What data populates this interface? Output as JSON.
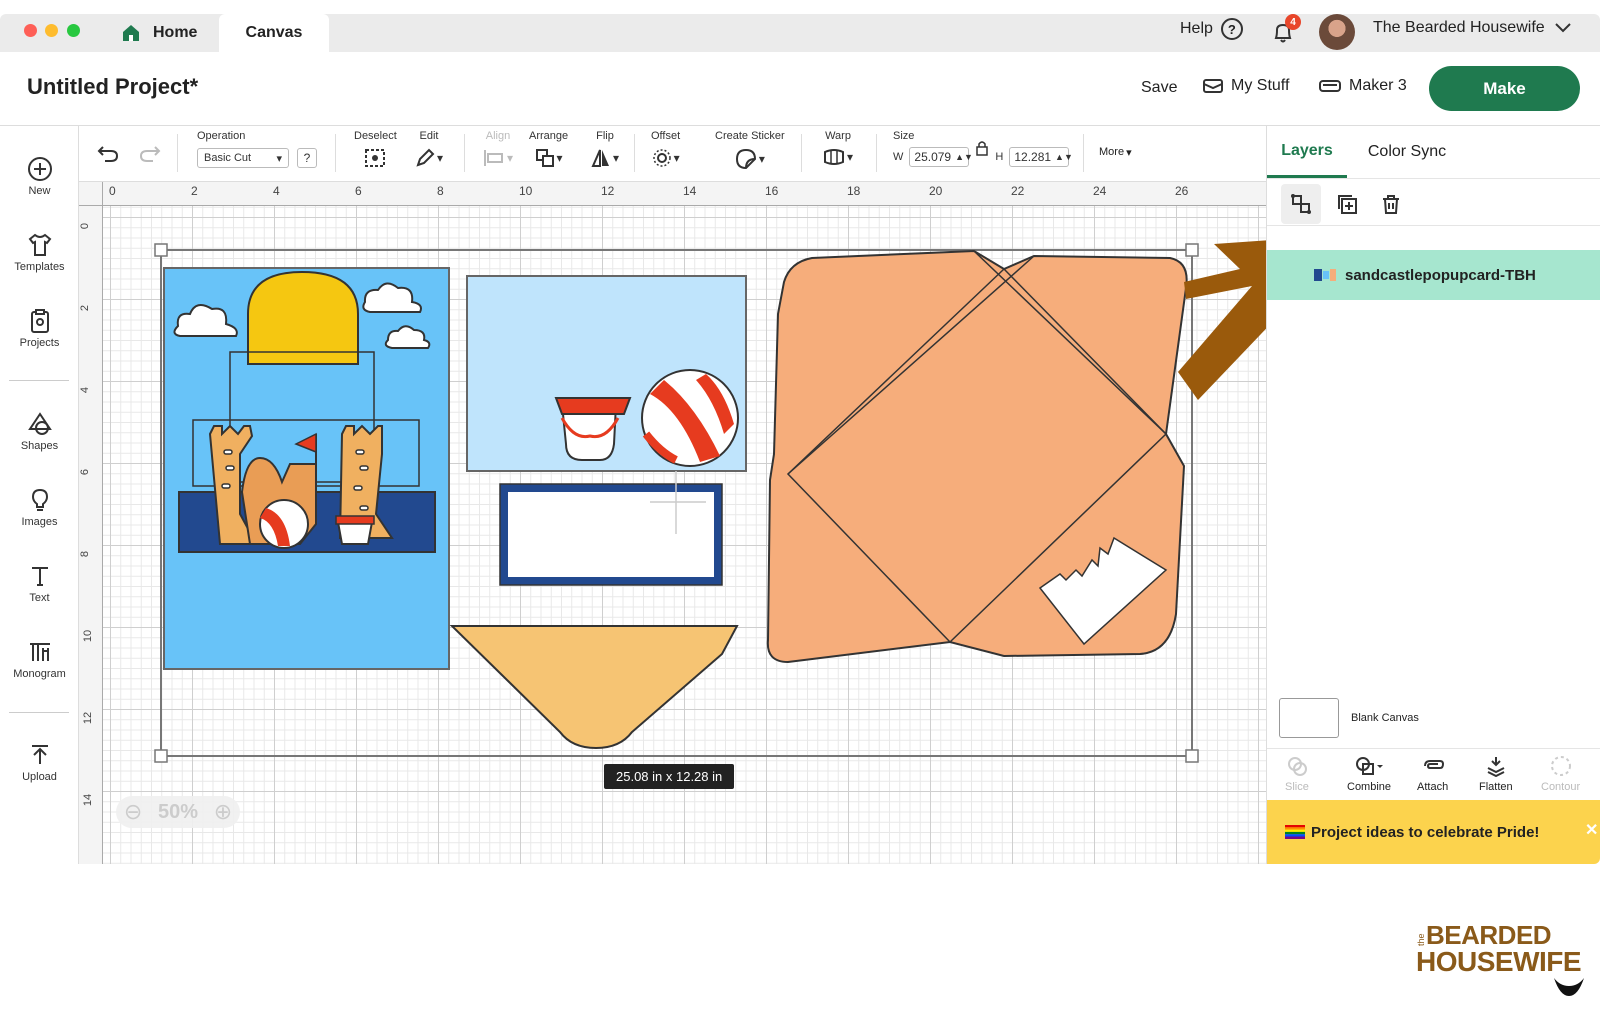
{
  "window": {
    "tabs": [
      {
        "label": "Home"
      },
      {
        "label": "Canvas"
      }
    ]
  },
  "topbar": {
    "help_label": "Help",
    "notification_count": "4",
    "user_name": "The Bearded Housewife"
  },
  "header": {
    "project_title": "Untitled Project*",
    "save_label": "Save",
    "mystuff_label": "My Stuff",
    "maker_label": "Maker 3",
    "make_label": "Make"
  },
  "sidebar": {
    "items": [
      {
        "label": "New",
        "icon": "plus-circle-icon"
      },
      {
        "label": "Templates",
        "icon": "shirt-icon"
      },
      {
        "label": "Projects",
        "icon": "clipboard-icon"
      },
      {
        "label": "Shapes",
        "icon": "shapes-icon"
      },
      {
        "label": "Images",
        "icon": "lightbulb-icon"
      },
      {
        "label": "Text",
        "icon": "text-icon"
      },
      {
        "label": "Monogram",
        "icon": "monogram-icon"
      },
      {
        "label": "Upload",
        "icon": "upload-icon"
      }
    ]
  },
  "toolbar": {
    "operation_label": "Operation",
    "operation_value": "Basic Cut",
    "help_q": "?",
    "deselect_label": "Deselect",
    "edit_label": "Edit",
    "align_label": "Align",
    "arrange_label": "Arrange",
    "flip_label": "Flip",
    "offset_label": "Offset",
    "sticker_label": "Create Sticker",
    "warp_label": "Warp",
    "size_label": "Size",
    "w_label": "W",
    "w_value": "25.079",
    "h_label": "H",
    "h_value": "12.281",
    "more_label": "More"
  },
  "ruler": {
    "h": [
      "0",
      "2",
      "4",
      "6",
      "8",
      "10",
      "12",
      "14",
      "16",
      "18",
      "20",
      "22",
      "24",
      "26"
    ],
    "v": [
      "0",
      "2",
      "4",
      "6",
      "8",
      "10",
      "12",
      "14"
    ]
  },
  "canvas": {
    "zoom": "50%",
    "selection_size": "25.08  in x 12.28  in"
  },
  "layers_panel": {
    "tab_layers": "Layers",
    "tab_colorsync": "Color Sync",
    "layer_name": "sandcastlepopupcard-TBH",
    "blank_canvas_label": "Blank Canvas",
    "bottom_tools": [
      {
        "label": "Slice",
        "enabled": false
      },
      {
        "label": "Combine",
        "enabled": true
      },
      {
        "label": "Attach",
        "enabled": true
      },
      {
        "label": "Flatten",
        "enabled": true
      },
      {
        "label": "Contour",
        "enabled": false
      }
    ],
    "promo_text": "Project ideas to celebrate Pride!"
  },
  "watermark": {
    "line1": "BEARDED",
    "line2": "HOUSEWIFE",
    "small": "the"
  },
  "colors": {
    "accent": "#1f7a4f",
    "layer_highlight": "#a6e6cf",
    "promo": "#fcd34d",
    "arrow": "#9a5a0c"
  }
}
